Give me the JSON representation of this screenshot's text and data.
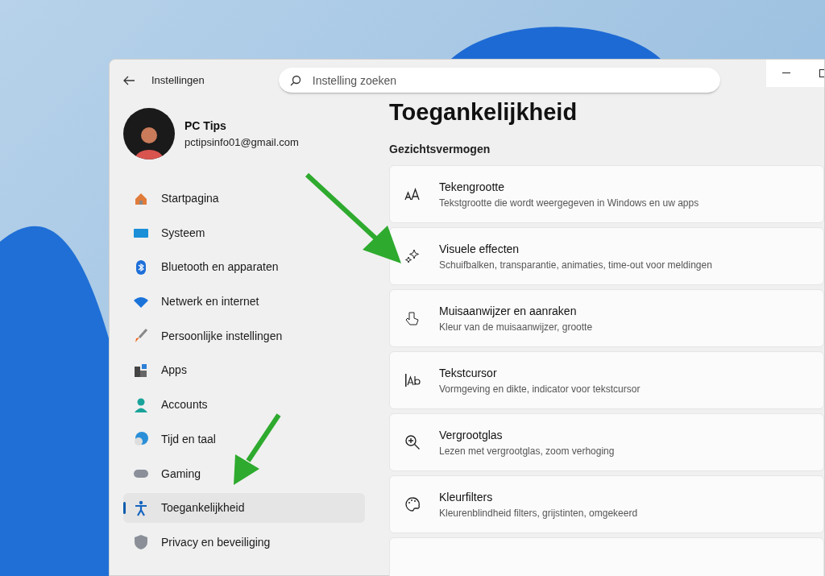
{
  "window": {
    "title": "Instellingen"
  },
  "search": {
    "placeholder": "Instelling zoeken"
  },
  "account": {
    "name": "PC Tips",
    "email": "pctipsinfo01@gmail.com"
  },
  "sidebar": {
    "items": [
      {
        "label": "Startpagina",
        "kind": "home",
        "selected": false
      },
      {
        "label": "Systeem",
        "kind": "system",
        "selected": false
      },
      {
        "label": "Bluetooth en apparaten",
        "kind": "bluetooth",
        "selected": false
      },
      {
        "label": "Netwerk en internet",
        "kind": "wifi",
        "selected": false
      },
      {
        "label": "Persoonlijke instellingen",
        "kind": "brush",
        "selected": false
      },
      {
        "label": "Apps",
        "kind": "apps",
        "selected": false
      },
      {
        "label": "Accounts",
        "kind": "person",
        "selected": false
      },
      {
        "label": "Tijd en taal",
        "kind": "globe",
        "selected": false
      },
      {
        "label": "Gaming",
        "kind": "gamepad",
        "selected": false
      },
      {
        "label": "Toegankelijkheid",
        "kind": "accessibility",
        "selected": true
      },
      {
        "label": "Privacy en beveiliging",
        "kind": "shield",
        "selected": false
      }
    ]
  },
  "page": {
    "title": "Toegankelijkheid",
    "section": "Gezichtsvermogen",
    "cards": [
      {
        "kind": "text-size",
        "title": "Tekengrootte",
        "description": "Tekstgrootte die wordt weergegeven in Windows en uw apps"
      },
      {
        "kind": "sparkle",
        "title": "Visuele effecten",
        "description": "Schuifbalken, transparantie, animaties, time-out voor meldingen"
      },
      {
        "kind": "pointer",
        "title": "Muisaanwijzer en aanraken",
        "description": "Kleur van de muisaanwijzer, grootte"
      },
      {
        "kind": "cursor",
        "title": "Tekstcursor",
        "description": "Vormgeving en dikte, indicator voor tekstcursor"
      },
      {
        "kind": "magnifier",
        "title": "Vergrootglas",
        "description": "Lezen met vergrootglas, zoom verhoging"
      },
      {
        "kind": "palette",
        "title": "Kleurfilters",
        "description": "Kleurenblindheid filters, grijstinten, omgekeerd"
      }
    ]
  }
}
